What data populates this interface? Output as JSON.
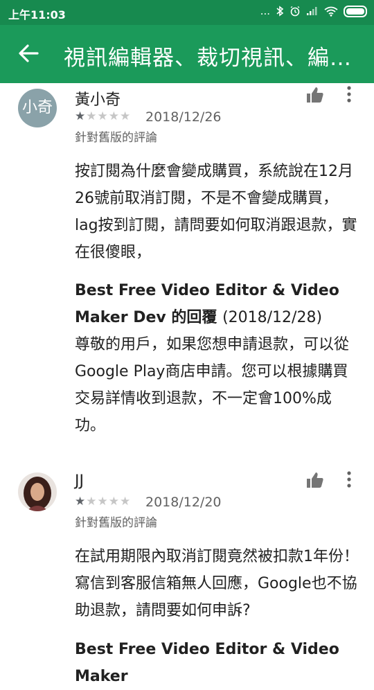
{
  "status_bar": {
    "time": "上午11:03",
    "dots": "..."
  },
  "app_bar": {
    "title": "視訊編輯器、裁切視訊、編…"
  },
  "reviews": [
    {
      "avatar_text": "小奇",
      "name": "黃小奇",
      "rating": 1,
      "stars_filled": "★",
      "stars_empty": "★★★★",
      "date": "2018/12/26",
      "old_version_label": "針對舊版的評論",
      "body": "按訂閱為什麼會變成購買，系統說在12月26號前取消訂閱，不是不會變成購買，lag按到訂閱，請問要如何取消跟退款，實在很傻眼，",
      "reply": {
        "author": "Best Free Video Editor & Video Maker Dev 的回覆",
        "date": "(2018/12/28)",
        "body": "尊敬的用戶，如果您想申請退款，可以從Google Play商店申請。您可以根據購買交易詳情收到退款，不一定會100%成功。"
      }
    },
    {
      "name": "JJ",
      "rating": 1,
      "stars_filled": "★",
      "stars_empty": "★★★★",
      "date": "2018/12/20",
      "old_version_label": "針對舊版的評論",
      "body": "在試用期限內取消訂閱竟然被扣款1年份！寫信到客服信箱無人回應，Google也不協助退款，請問要如何申訴?",
      "reply": {
        "author": "Best Free Video Editor & Video Maker"
      }
    }
  ],
  "colors": {
    "status_bar": "#178a4f",
    "app_bar": "#1b9a5a"
  }
}
